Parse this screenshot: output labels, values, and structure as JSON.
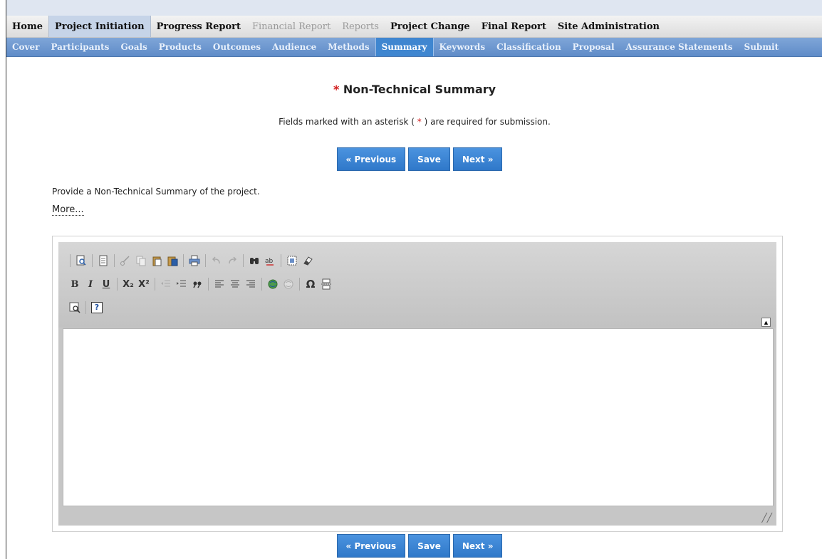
{
  "main_nav": [
    {
      "label": "Home",
      "state": "normal"
    },
    {
      "label": "Project Initiation",
      "state": "active"
    },
    {
      "label": "Progress Report",
      "state": "normal"
    },
    {
      "label": "Financial Report",
      "state": "disabled"
    },
    {
      "label": "Reports",
      "state": "disabled"
    },
    {
      "label": "Project Change",
      "state": "normal"
    },
    {
      "label": "Final Report",
      "state": "normal"
    },
    {
      "label": "Site Administration",
      "state": "normal"
    }
  ],
  "sub_nav": [
    {
      "label": "Cover"
    },
    {
      "label": "Participants"
    },
    {
      "label": "Goals"
    },
    {
      "label": "Products"
    },
    {
      "label": "Outcomes"
    },
    {
      "label": "Audience"
    },
    {
      "label": "Methods"
    },
    {
      "label": "Summary",
      "active": true
    },
    {
      "label": "Keywords"
    },
    {
      "label": "Classification"
    },
    {
      "label": "Proposal"
    },
    {
      "label": "Assurance Statements"
    },
    {
      "label": "Submit"
    }
  ],
  "page": {
    "asterisk": "*",
    "title": "Non-Technical Summary",
    "required_note_pre": "Fields marked with an asterisk (",
    "required_note_asterisk": " * ",
    "required_note_post": ") are required for submission.",
    "prompt": "Provide a Non-Technical Summary of the project.",
    "more_link": "More..."
  },
  "buttons": {
    "previous": "« Previous",
    "save": "Save",
    "next": "Next »"
  },
  "editor": {
    "content": "",
    "toolbar": {
      "row1": [
        "preview-icon",
        "templates-icon",
        "cut-icon",
        "copy-icon",
        "paste-icon",
        "paste-from-word-icon",
        "print-icon",
        "undo-icon",
        "redo-icon",
        "find-icon",
        "replace-icon",
        "select-all-icon",
        "remove-format-icon"
      ],
      "row2": [
        "bold-icon",
        "italic-icon",
        "underline-icon",
        "subscript-icon",
        "superscript-icon",
        "outdent-icon",
        "indent-icon",
        "blockquote-icon",
        "align-left-icon",
        "align-center-icon",
        "align-right-icon",
        "link-icon",
        "unlink-icon",
        "special-char-icon",
        "page-break-icon"
      ],
      "row3": [
        "spellcheck-icon",
        "about-icon"
      ]
    },
    "labels": {
      "bold": "B",
      "italic": "I",
      "underline": "U",
      "subscript": "X₂",
      "superscript": "X²",
      "special_char": "Ω",
      "about": "?"
    }
  },
  "colors": {
    "accent": "#3f86d0",
    "required": "#d21f1f",
    "subnav": "#6f98d0"
  }
}
